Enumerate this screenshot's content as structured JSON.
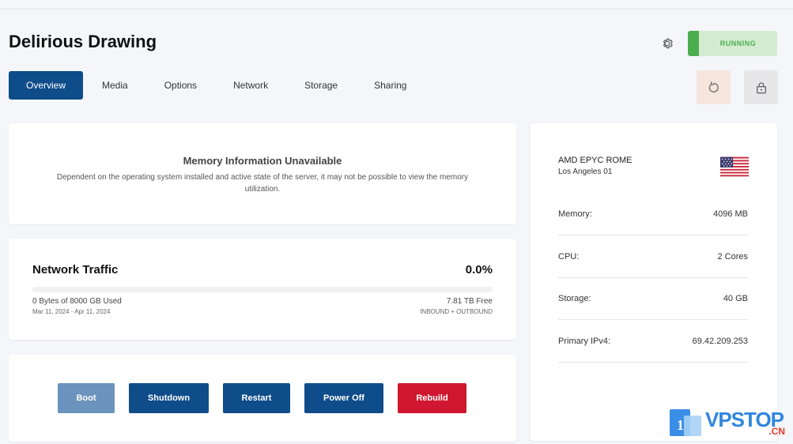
{
  "server": {
    "title": "Delirious Drawing",
    "status": "RUNNING"
  },
  "tabs": [
    "Overview",
    "Media",
    "Options",
    "Network",
    "Storage",
    "Sharing"
  ],
  "memory_card": {
    "title": "Memory Information Unavailable",
    "description": "Dependent on the operating system installed and active state of the server, it may not be possible to view the memory utilization."
  },
  "network_card": {
    "title": "Network Traffic",
    "percent": "0.0%",
    "percent_value": 0.0,
    "used": "0 Bytes of 8000 GB Used",
    "dates": "Mar 11, 2024 - Apr 11, 2024",
    "free": "7.81 TB Free",
    "direction": "INBOUND + OUTBOUND"
  },
  "actions": {
    "boot": "Boot",
    "shutdown": "Shutdown",
    "restart": "Restart",
    "power_off": "Power Off",
    "rebuild": "Rebuild"
  },
  "specs": {
    "cpu_name": "AMD EPYC ROME",
    "location": "Los Angeles 01",
    "rows": [
      {
        "label": "Memory:",
        "value": "4096 MB"
      },
      {
        "label": "CPU:",
        "value": "2 Cores"
      },
      {
        "label": "Storage:",
        "value": "40 GB"
      },
      {
        "label": "Primary IPv4:",
        "value": "69.42.209.253"
      }
    ]
  },
  "watermark": {
    "digit": "1",
    "brand": "VPSTOP",
    "suffix": ".CN"
  },
  "colors": {
    "primary": "#0f4c8a",
    "boot_disabled": "#6b93bd",
    "rebuild": "#d0172f",
    "running_green": "#4cae4f"
  }
}
